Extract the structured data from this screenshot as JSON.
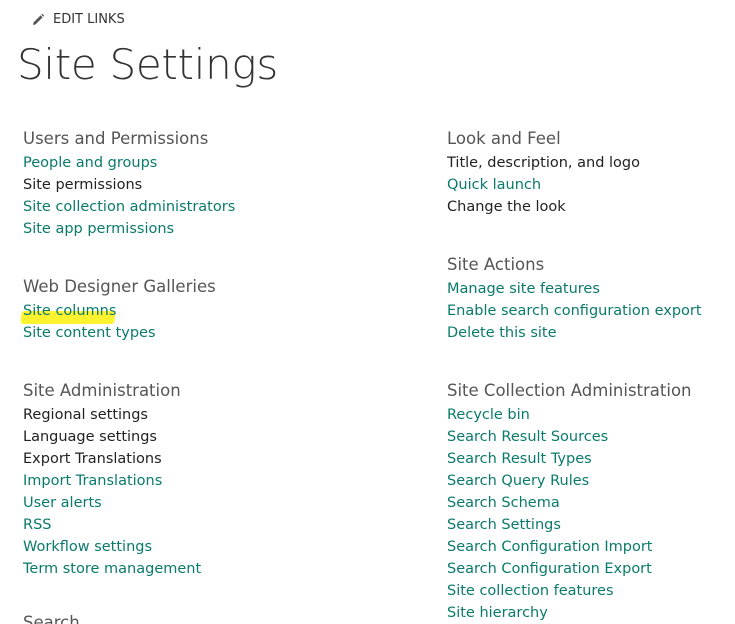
{
  "edit_links": {
    "label": "EDIT LINKS",
    "icon": "pencil-icon"
  },
  "page_title": "Site Settings",
  "colors": {
    "link": "#0a7a6c",
    "dark_text": "#222222",
    "heading": "#555555",
    "highlight": "#fff21a"
  },
  "sections": {
    "users_and_permissions": {
      "heading": "Users and Permissions",
      "links": [
        {
          "label": "People and groups"
        },
        {
          "label": "Site permissions"
        },
        {
          "label": "Site collection administrators"
        },
        {
          "label": "Site app permissions"
        }
      ]
    },
    "web_designer_galleries": {
      "heading": "Web Designer Galleries",
      "links": [
        {
          "label": "Site columns",
          "highlighted": true
        },
        {
          "label": "Site content types"
        }
      ]
    },
    "site_administration": {
      "heading": "Site Administration",
      "links": [
        {
          "label": "Regional settings"
        },
        {
          "label": "Language settings"
        },
        {
          "label": "Export Translations"
        },
        {
          "label": "Import Translations"
        },
        {
          "label": "User alerts"
        },
        {
          "label": "RSS"
        },
        {
          "label": "Workflow settings"
        },
        {
          "label": "Term store management"
        }
      ]
    },
    "search": {
      "heading": "Search"
    },
    "look_and_feel": {
      "heading": "Look and Feel",
      "links": [
        {
          "label": "Title, description, and logo"
        },
        {
          "label": "Quick launch"
        },
        {
          "label": "Change the look"
        }
      ]
    },
    "site_actions": {
      "heading": "Site Actions",
      "links": [
        {
          "label": "Manage site features"
        },
        {
          "label": "Enable search configuration export"
        },
        {
          "label": "Delete this site"
        }
      ]
    },
    "site_collection_administration": {
      "heading": "Site Collection Administration",
      "links": [
        {
          "label": "Recycle bin"
        },
        {
          "label": "Search Result Sources"
        },
        {
          "label": "Search Result Types"
        },
        {
          "label": "Search Query Rules"
        },
        {
          "label": "Search Schema"
        },
        {
          "label": "Search Settings"
        },
        {
          "label": "Search Configuration Import"
        },
        {
          "label": "Search Configuration Export"
        },
        {
          "label": "Site collection features"
        },
        {
          "label": "Site hierarchy"
        }
      ]
    }
  }
}
